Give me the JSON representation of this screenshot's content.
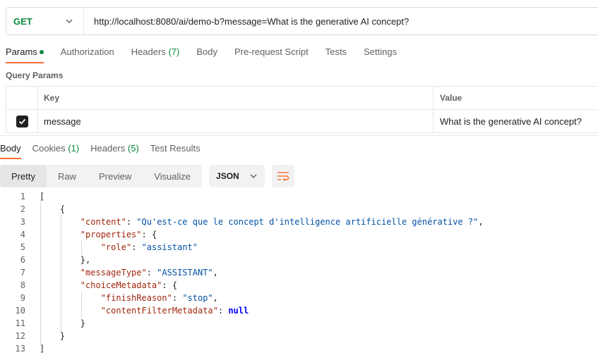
{
  "request": {
    "method": "GET",
    "url": "http://localhost:8080/ai/demo-b?message=What is the generative AI concept?"
  },
  "request_tabs": [
    {
      "label": "Params",
      "active": true,
      "dot": true
    },
    {
      "label": "Authorization"
    },
    {
      "label": "Headers",
      "count": "(7)"
    },
    {
      "label": "Body"
    },
    {
      "label": "Pre-request Script"
    },
    {
      "label": "Tests"
    },
    {
      "label": "Settings"
    }
  ],
  "query_params": {
    "title": "Query Params",
    "headers": {
      "key": "Key",
      "value": "Value"
    },
    "rows": [
      {
        "checked": true,
        "key": "message",
        "value": "What is the generative AI concept?"
      }
    ]
  },
  "response_tabs": [
    {
      "label": "Body",
      "active": true
    },
    {
      "label": "Cookies",
      "count": "(1)"
    },
    {
      "label": "Headers",
      "count": "(5)"
    },
    {
      "label": "Test Results"
    }
  ],
  "view_modes": [
    {
      "label": "Pretty",
      "active": true
    },
    {
      "label": "Raw"
    },
    {
      "label": "Preview"
    },
    {
      "label": "Visualize"
    }
  ],
  "format": {
    "label": "JSON",
    "icon": "chevron-down-icon"
  },
  "wrap_icon": "word-wrap-icon",
  "colors": {
    "accent": "#ff6c37",
    "method": "#0b8a3e",
    "json_key": "#a1260d",
    "json_string": "#0451a5",
    "json_keyword": "#0000ff"
  },
  "code_lines": [
    {
      "n": "1",
      "tokens": [
        {
          "t": "p",
          "v": "["
        }
      ]
    },
    {
      "n": "2",
      "tokens": [
        {
          "t": "p",
          "v": "    {"
        }
      ]
    },
    {
      "n": "3",
      "tokens": [
        {
          "t": "p",
          "v": "        "
        },
        {
          "t": "k",
          "v": "\"content\""
        },
        {
          "t": "p",
          "v": ": "
        },
        {
          "t": "s",
          "v": "\"Qu'est-ce que le concept d'intelligence artificielle générative ?\""
        },
        {
          "t": "p",
          "v": ","
        }
      ]
    },
    {
      "n": "4",
      "tokens": [
        {
          "t": "p",
          "v": "        "
        },
        {
          "t": "k",
          "v": "\"properties\""
        },
        {
          "t": "p",
          "v": ": {"
        }
      ]
    },
    {
      "n": "5",
      "tokens": [
        {
          "t": "p",
          "v": "            "
        },
        {
          "t": "k",
          "v": "\"role\""
        },
        {
          "t": "p",
          "v": ": "
        },
        {
          "t": "s",
          "v": "\"assistant\""
        }
      ]
    },
    {
      "n": "6",
      "tokens": [
        {
          "t": "p",
          "v": "        },"
        }
      ]
    },
    {
      "n": "7",
      "tokens": [
        {
          "t": "p",
          "v": "        "
        },
        {
          "t": "k",
          "v": "\"messageType\""
        },
        {
          "t": "p",
          "v": ": "
        },
        {
          "t": "s",
          "v": "\"ASSISTANT\""
        },
        {
          "t": "p",
          "v": ","
        }
      ]
    },
    {
      "n": "8",
      "tokens": [
        {
          "t": "p",
          "v": "        "
        },
        {
          "t": "k",
          "v": "\"choiceMetadata\""
        },
        {
          "t": "p",
          "v": ": {"
        }
      ]
    },
    {
      "n": "9",
      "tokens": [
        {
          "t": "p",
          "v": "            "
        },
        {
          "t": "k",
          "v": "\"finishReason\""
        },
        {
          "t": "p",
          "v": ": "
        },
        {
          "t": "s",
          "v": "\"stop\""
        },
        {
          "t": "p",
          "v": ","
        }
      ]
    },
    {
      "n": "10",
      "tokens": [
        {
          "t": "p",
          "v": "            "
        },
        {
          "t": "k",
          "v": "\"contentFilterMetadata\""
        },
        {
          "t": "p",
          "v": ": "
        },
        {
          "t": "kw",
          "v": "null"
        }
      ]
    },
    {
      "n": "11",
      "tokens": [
        {
          "t": "p",
          "v": "        }"
        }
      ]
    },
    {
      "n": "12",
      "tokens": [
        {
          "t": "p",
          "v": "    }"
        }
      ]
    },
    {
      "n": "13",
      "tokens": [
        {
          "t": "p",
          "v": "]"
        }
      ]
    }
  ]
}
